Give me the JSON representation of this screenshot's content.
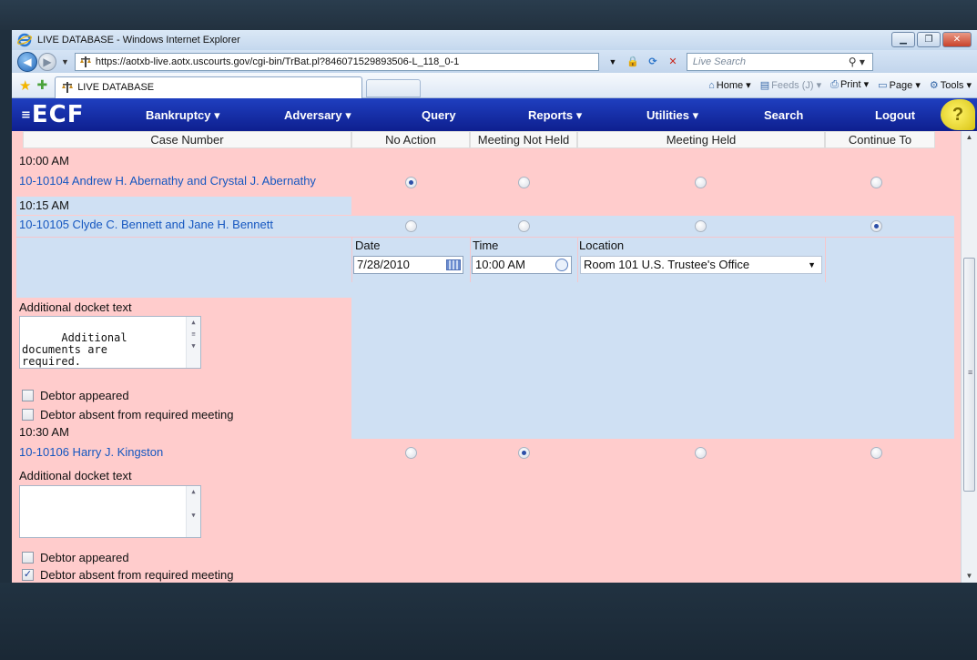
{
  "browser": {
    "window_title": "LIVE DATABASE - Windows Internet Explorer",
    "url": "https://aotxb-live.aotx.uscourts.gov/cgi-bin/TrBat.pl?846071529893506-L_118_0-1",
    "search_placeholder": "Live Search",
    "tab_title": "LIVE DATABASE",
    "commands": {
      "home": "Home",
      "feeds": "Feeds (J)",
      "print": "Print",
      "page": "Page",
      "tools": "Tools"
    }
  },
  "ecf": {
    "logo": "ECF",
    "menu": [
      "Bankruptcy",
      "Adversary",
      "Query",
      "Reports",
      "Utilities",
      "Search",
      "Logout"
    ]
  },
  "table": {
    "headers": [
      "Case Number",
      "No Action",
      "Meeting Not Held",
      "Meeting Held",
      "Continue To"
    ],
    "groups": [
      {
        "time": "10:00 AM",
        "case": "10-10104 Andrew H. Abernathy and Crystal J. Abernathy",
        "selected": "No Action"
      },
      {
        "time": "10:15 AM",
        "case": "10-10105 Clyde C. Bennett and Jane H. Bennett",
        "selected": "Continue To",
        "continue": {
          "date_label": "Date",
          "date_value": "7/28/2010",
          "time_label": "Time",
          "time_value": "10:00 AM",
          "location_label": "Location",
          "location_value": "Room 101 U.S. Trustee's Office"
        },
        "docket_label": "Additional docket text",
        "docket_text": "Additional\ndocuments are\nrequired.",
        "debtor_appeared_label": "Debtor appeared",
        "debtor_appeared": false,
        "debtor_absent_label": "Debtor absent from required meeting",
        "debtor_absent": false
      },
      {
        "time": "10:30 AM",
        "case": "10-10106 Harry J. Kingston",
        "selected": "Meeting Not Held",
        "docket_label": "Additional docket text",
        "docket_text": "",
        "debtor_appeared_label": "Debtor appeared",
        "debtor_appeared": false,
        "debtor_absent_label": "Debtor absent from required meeting",
        "debtor_absent": true
      }
    ]
  },
  "colors": {
    "row_pink": "#ffcccc",
    "row_blue": "#cfe0f3",
    "ecf_nav": "#1530a8",
    "link": "#1557c0"
  }
}
